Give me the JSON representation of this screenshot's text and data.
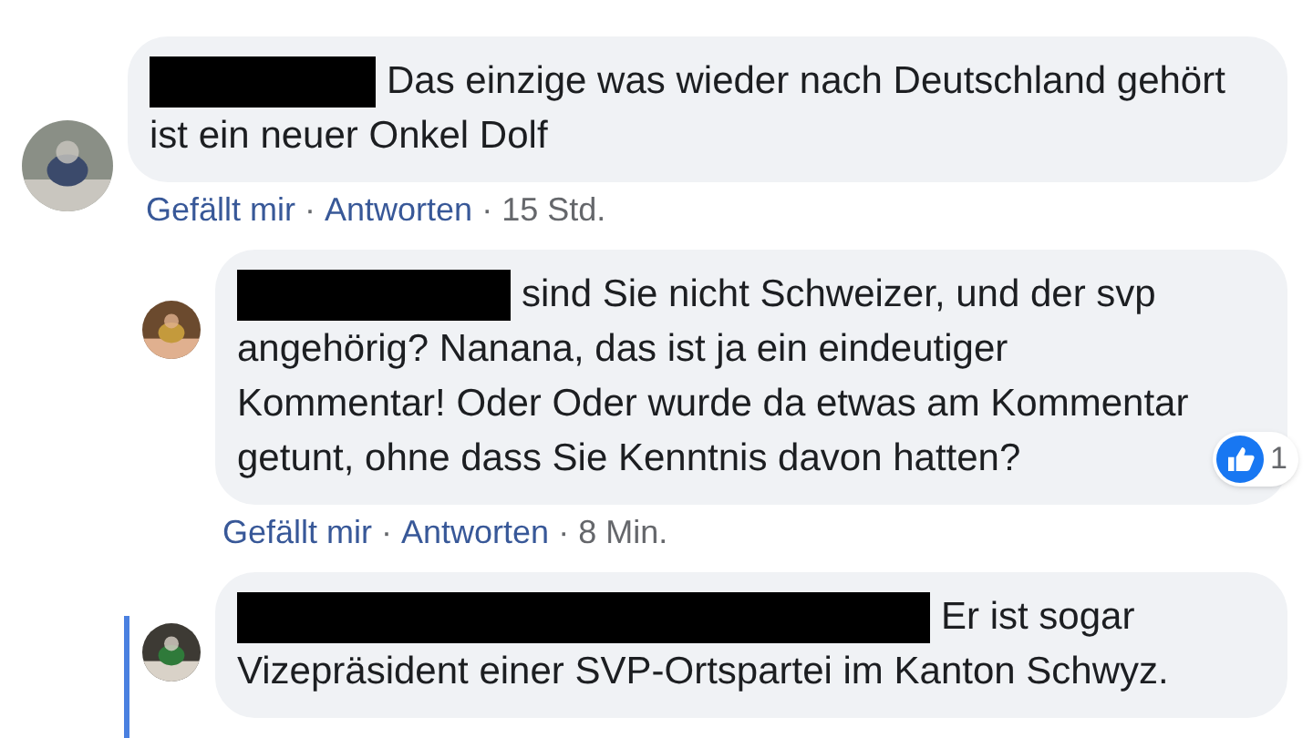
{
  "comments": [
    {
      "kind": "top",
      "text": "Das einzige was wieder nach Deutschland gehört ist ein neuer Onkel Dolf",
      "actions": {
        "like": "Gefällt mir",
        "sep1": "·",
        "reply": "Antworten",
        "sep2": "·",
        "time": "15 Std."
      }
    },
    {
      "kind": "reply",
      "text": "sind Sie nicht Schweizer, und der svp angehörig? Nanana, das ist ja ein eindeutiger Kommentar! Oder Oder wurde da etwas am Kommentar getunt, ohne dass Sie Kenntnis davon hatten?",
      "reaction": {
        "count": "1"
      },
      "actions": {
        "like": "Gefällt mir",
        "sep1": "·",
        "reply": "Antworten",
        "sep2": "·",
        "time": "8 Min."
      }
    },
    {
      "kind": "reply",
      "text": "Er ist sogar Vizepräsident einer SVP-Ortspartei im Kanton Schwyz.",
      "thread_line": true
    }
  ]
}
